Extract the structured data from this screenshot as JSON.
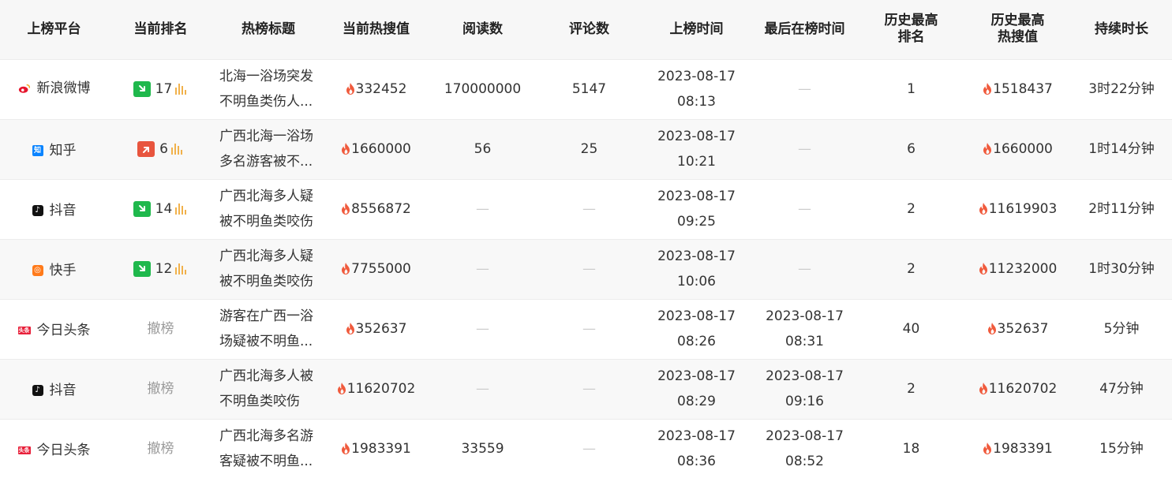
{
  "headers": [
    "上榜平台",
    "当前排名",
    "热榜标题",
    "当前热搜值",
    "阅读数",
    "评论数",
    "上榜时间",
    "最后在榜时间",
    "历史最高\n排名",
    "历史最高\n热搜值",
    "持续时长"
  ],
  "colors": {
    "flame": "#f05a3c",
    "rank_down": "#1fb84c",
    "rank_up": "#e8553e",
    "bars": "#f1b14b",
    "weibo": "#e6162d",
    "zhihu": "#0a84ff",
    "kuaishou": "#ff7a1a",
    "toutiao": "#e8203a"
  },
  "rows": [
    {
      "platform": "新浪微博",
      "platform_icon": "weibo-icon",
      "rank": "17",
      "rank_trend": "down",
      "title_line1": "北海一浴场突发",
      "title_line2": "不明鱼类伤人...",
      "hot": "332452",
      "reads": "170000000",
      "comments": "5147",
      "start_date": "2023-08-17",
      "start_time": "08:13",
      "last_date": "—",
      "last_time": "",
      "best_rank": "1",
      "best_hot": "1518437",
      "duration": "3时22分钟"
    },
    {
      "platform": "知乎",
      "platform_icon": "zhihu-icon",
      "rank": "6",
      "rank_trend": "up",
      "title_line1": "广西北海一浴场",
      "title_line2": "多名游客被不...",
      "hot": "1660000",
      "reads": "56",
      "comments": "25",
      "start_date": "2023-08-17",
      "start_time": "10:21",
      "last_date": "—",
      "last_time": "",
      "best_rank": "6",
      "best_hot": "1660000",
      "duration": "1时14分钟"
    },
    {
      "platform": "抖音",
      "platform_icon": "douyin-icon",
      "rank": "14",
      "rank_trend": "down",
      "title_line1": "广西北海多人疑",
      "title_line2": "被不明鱼类咬伤",
      "hot": "8556872",
      "reads": "—",
      "comments": "—",
      "start_date": "2023-08-17",
      "start_time": "09:25",
      "last_date": "—",
      "last_time": "",
      "best_rank": "2",
      "best_hot": "11619903",
      "duration": "2时11分钟"
    },
    {
      "platform": "快手",
      "platform_icon": "kuaishou-icon",
      "rank": "12",
      "rank_trend": "down",
      "title_line1": "广西北海多人疑",
      "title_line2": "被不明鱼类咬伤",
      "hot": "7755000",
      "reads": "—",
      "comments": "—",
      "start_date": "2023-08-17",
      "start_time": "10:06",
      "last_date": "—",
      "last_time": "",
      "best_rank": "2",
      "best_hot": "11232000",
      "duration": "1时30分钟"
    },
    {
      "platform": "今日头条",
      "platform_icon": "toutiao-icon",
      "rank": "撤榜",
      "rank_trend": "removed",
      "title_line1": "游客在广西一浴",
      "title_line2": "场疑被不明鱼...",
      "hot": "352637",
      "reads": "—",
      "comments": "—",
      "start_date": "2023-08-17",
      "start_time": "08:26",
      "last_date": "2023-08-17",
      "last_time": "08:31",
      "best_rank": "40",
      "best_hot": "352637",
      "duration": "5分钟"
    },
    {
      "platform": "抖音",
      "platform_icon": "douyin-icon",
      "rank": "撤榜",
      "rank_trend": "removed",
      "title_line1": "广西北海多人被",
      "title_line2": "不明鱼类咬伤",
      "hot": "11620702",
      "reads": "—",
      "comments": "—",
      "start_date": "2023-08-17",
      "start_time": "08:29",
      "last_date": "2023-08-17",
      "last_time": "09:16",
      "best_rank": "2",
      "best_hot": "11620702",
      "duration": "47分钟"
    },
    {
      "platform": "今日头条",
      "platform_icon": "toutiao-icon",
      "rank": "撤榜",
      "rank_trend": "removed",
      "title_line1": "广西北海多名游",
      "title_line2": "客疑被不明鱼...",
      "hot": "1983391",
      "reads": "33559",
      "comments": "—",
      "start_date": "2023-08-17",
      "start_time": "08:36",
      "last_date": "2023-08-17",
      "last_time": "08:52",
      "best_rank": "18",
      "best_hot": "1983391",
      "duration": "15分钟"
    }
  ]
}
